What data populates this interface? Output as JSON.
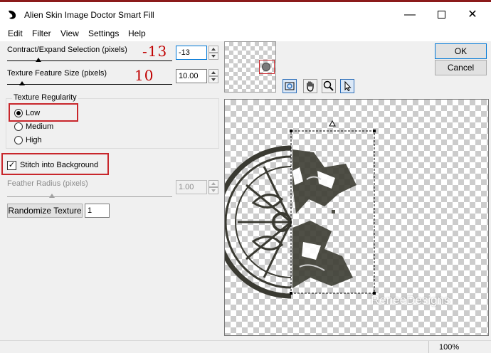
{
  "window": {
    "title": "Alien Skin Image Doctor Smart Fill"
  },
  "menu": [
    "Edit",
    "Filter",
    "View",
    "Settings",
    "Help"
  ],
  "controls": {
    "contract": {
      "label": "Contract/Expand Selection (pixels)",
      "value": "-13",
      "annotation": "-13",
      "slider_fraction": 0.19
    },
    "texture_size": {
      "label": "Texture Feature Size (pixels)",
      "value": "10.00",
      "annotation": "10",
      "slider_fraction": 0.09
    },
    "regularity": {
      "title": "Texture Regularity",
      "options": [
        "Low",
        "Medium",
        "High"
      ],
      "selected": "Low"
    },
    "stitch": {
      "label": "Stitch into Background",
      "checked": true,
      "mark": "✓"
    },
    "feather": {
      "label": "Feather Radius (pixels)",
      "value": "1.00",
      "slider_fraction": 0.27
    },
    "randomize": {
      "label": "Randomize Texture",
      "value": "1"
    }
  },
  "buttons": {
    "ok": "OK",
    "cancel": "Cancel"
  },
  "canvas": {
    "watermark": "ReneeDesigns"
  },
  "status": {
    "zoom": "100%"
  },
  "colors": {
    "highlight": "#c8262b",
    "annotation": "#c00000",
    "accent": "#0078d7"
  },
  "tools": [
    "zoom-fit-icon",
    "hand-icon",
    "magnifier-icon",
    "arrow-cursor-icon"
  ]
}
